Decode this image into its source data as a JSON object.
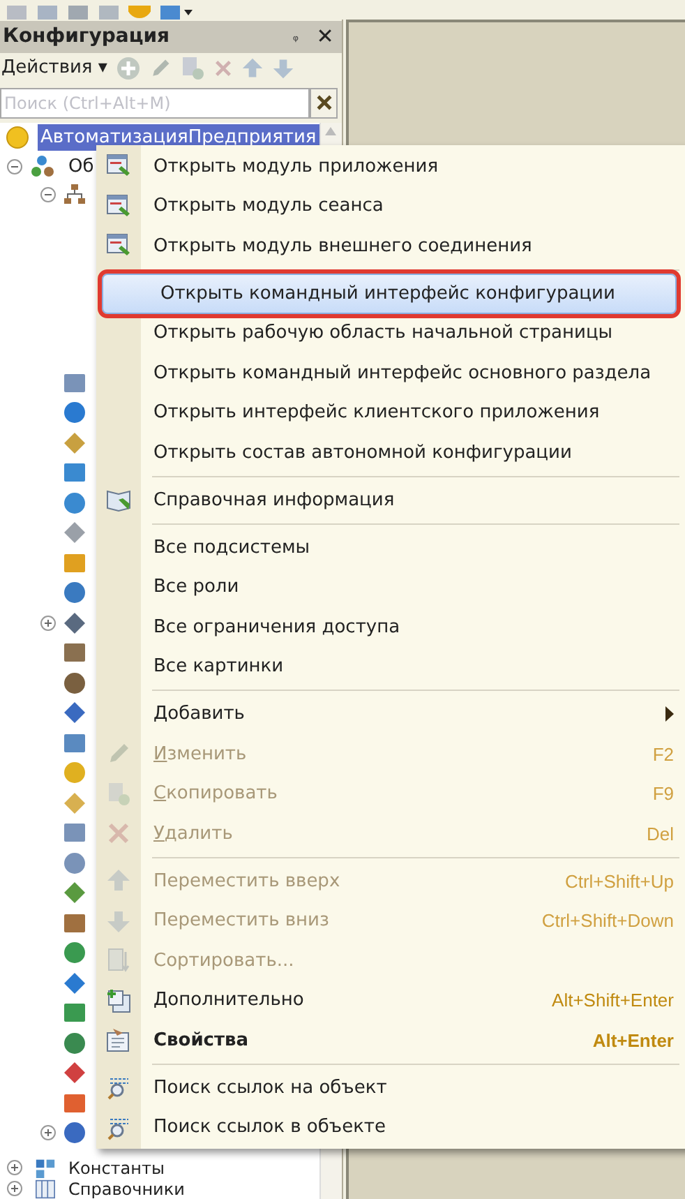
{
  "panel": {
    "title": "Конфигурация",
    "pin": "ᵩ",
    "close": "✕"
  },
  "actions": {
    "label": "Действия",
    "caret": "▾"
  },
  "search": {
    "placeholder": "Поиск (Ctrl+Alt+M)"
  },
  "tree_top": [
    {
      "label": "АвтоматизацияПредприятия",
      "selected": true
    },
    {
      "label": "Об",
      "selected": false
    }
  ],
  "tree_bottom": [
    {
      "label": "Константы"
    },
    {
      "label": "Справочники"
    }
  ],
  "menu": [
    {
      "kind": "item",
      "label": "Открыть модуль приложения",
      "selected": false,
      "disabled": false
    },
    {
      "kind": "item",
      "label": "Открыть модуль сеанса",
      "selected": false,
      "disabled": false
    },
    {
      "kind": "item",
      "label": "Открыть модуль внешнего соединения",
      "selected": false,
      "disabled": false
    },
    {
      "kind": "separator"
    },
    {
      "kind": "item",
      "label": "Открыть командный интерфейс конфигурации",
      "selected": true,
      "disabled": false
    },
    {
      "kind": "item",
      "label": "Открыть рабочую область начальной страницы",
      "selected": false,
      "disabled": false
    },
    {
      "kind": "item",
      "label": "Открыть командный интерфейс основного раздела",
      "selected": false,
      "disabled": false
    },
    {
      "kind": "item",
      "label": "Открыть интерфейс клиентского приложения",
      "selected": false,
      "disabled": false
    },
    {
      "kind": "item",
      "label": "Открыть состав автономной конфигурации",
      "selected": false,
      "disabled": false
    },
    {
      "kind": "separator"
    },
    {
      "kind": "item",
      "label": "Справочная информация",
      "selected": false,
      "disabled": false
    },
    {
      "kind": "separator"
    },
    {
      "kind": "item",
      "label": "Все подсистемы",
      "selected": false,
      "disabled": false
    },
    {
      "kind": "item",
      "label": "Все роли",
      "selected": false,
      "disabled": false
    },
    {
      "kind": "item",
      "label": "Все ограничения доступа",
      "selected": false,
      "disabled": false
    },
    {
      "kind": "item",
      "label": "Все картинки",
      "selected": false,
      "disabled": false
    },
    {
      "kind": "separator"
    },
    {
      "kind": "submenu",
      "label": "Добавить",
      "selected": false,
      "disabled": false
    },
    {
      "kind": "item",
      "label": "Изменить",
      "shortcut": "F2",
      "selected": false,
      "disabled": true,
      "mnemonic": true
    },
    {
      "kind": "item",
      "label": "Скопировать",
      "shortcut": "F9",
      "selected": false,
      "disabled": true,
      "mnemonic": true
    },
    {
      "kind": "item",
      "label": "Удалить",
      "shortcut": "Del",
      "selected": false,
      "disabled": true,
      "mnemonic": true
    },
    {
      "kind": "separator"
    },
    {
      "kind": "item",
      "label": "Переместить вверх",
      "shortcut": "Ctrl+Shift+Up",
      "selected": false,
      "disabled": true
    },
    {
      "kind": "item",
      "label": "Переместить вниз",
      "shortcut": "Ctrl+Shift+Down",
      "selected": false,
      "disabled": true
    },
    {
      "kind": "item",
      "label": "Сортировать...",
      "selected": false,
      "disabled": true
    },
    {
      "kind": "item",
      "label": "Дополнительно",
      "shortcut": "Alt+Shift+Enter",
      "selected": false,
      "disabled": false
    },
    {
      "kind": "item",
      "label": "Свойства",
      "shortcut": "Alt+Enter",
      "selected": false,
      "disabled": false,
      "bold": true
    },
    {
      "kind": "separator"
    },
    {
      "kind": "item",
      "label": "Поиск ссылок на объект",
      "selected": false,
      "disabled": false
    },
    {
      "kind": "item",
      "label": "Поиск ссылок в объекте",
      "selected": false,
      "disabled": false
    }
  ]
}
